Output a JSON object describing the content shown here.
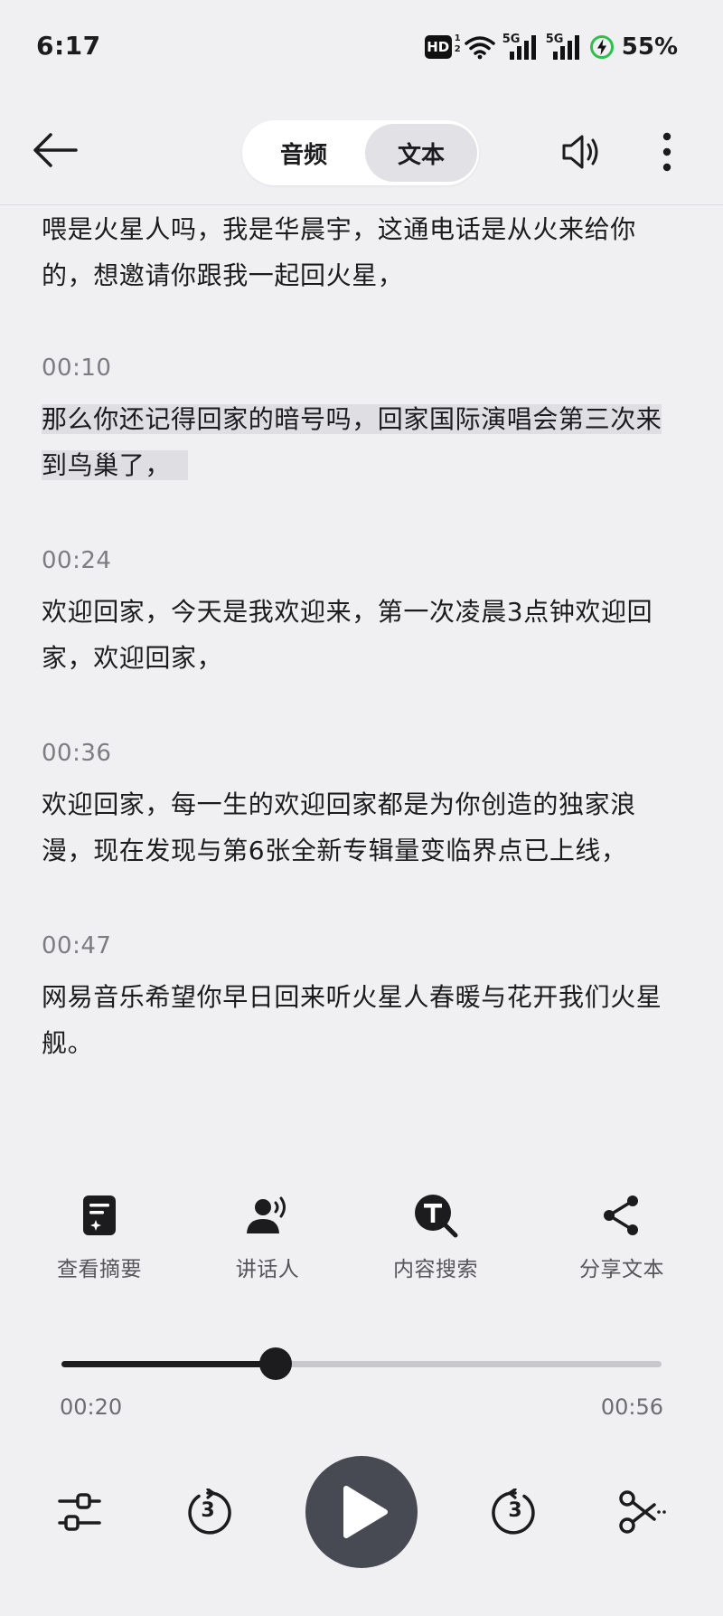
{
  "status_bar": {
    "time": "6:17",
    "hd_label": "HD",
    "hd_sub1": "1",
    "hd_sub2": "2",
    "signal1_label": "5G",
    "signal2_label": "5G",
    "battery_percent": "55%",
    "icons": [
      "hd-icon",
      "wifi-icon",
      "signal-icon",
      "signal-icon",
      "battery-charging-icon"
    ]
  },
  "header": {
    "tabs": [
      {
        "label": "音频",
        "selected": false
      },
      {
        "label": "文本",
        "selected": true
      }
    ],
    "icons": [
      "back-arrow-icon",
      "speaker-icon",
      "more-vertical-icon"
    ]
  },
  "transcript": {
    "intro_lines": [
      "喂是火星人吗，我是华晨宇，这通电话是从火来给你",
      "的，想邀请你跟我一起回火星，"
    ],
    "segments": [
      {
        "time": "00:10",
        "lines": [
          "那么你还记得回家的暗号吗，回家国际演唱会第三次来",
          "到鸟巢了，"
        ],
        "highlighted": true
      },
      {
        "time": "00:24",
        "lines": [
          "欢迎回家，今天是我欢迎来，第一次凌晨3点钟欢迎回",
          "家，欢迎回家，"
        ],
        "highlighted": false
      },
      {
        "time": "00:36",
        "lines": [
          "欢迎回家，每一生的欢迎回家都是为你创造的独家浪",
          "漫，现在发现与第6张全新专辑量变临界点已上线，"
        ],
        "highlighted": false
      },
      {
        "time": "00:47",
        "lines": [
          "网易音乐希望你早日回来听火星人春暖与花开我们火星",
          "舰。"
        ],
        "highlighted": false
      }
    ]
  },
  "actions": [
    {
      "label": "查看摘要",
      "icon": "summary-icon"
    },
    {
      "label": "讲话人",
      "icon": "speaker-person-icon"
    },
    {
      "label": "内容搜索",
      "icon": "text-search-icon"
    },
    {
      "label": "分享文本",
      "icon": "share-icon"
    }
  ],
  "player": {
    "current_time": "00:20",
    "total_time": "00:56",
    "progress": 0.357,
    "rewind_seconds": "3",
    "forward_seconds": "3",
    "icons": [
      "equalizer-icon",
      "rewind-icon",
      "play-icon",
      "forward-icon",
      "scissors-icon"
    ]
  },
  "colors": {
    "background": "#f0f0f2",
    "highlight": "#dfdfe3",
    "play_button": "#474953",
    "text_primary": "#1c1c1e",
    "text_secondary": "#7c7c82"
  }
}
